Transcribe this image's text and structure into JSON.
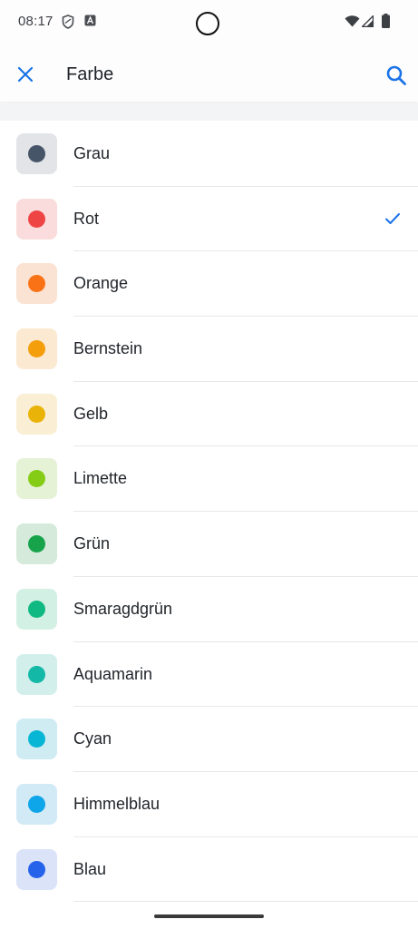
{
  "status_bar": {
    "time": "08:17",
    "icons": [
      "shield-icon",
      "notification-a-icon",
      "wifi-icon",
      "signal-icon",
      "battery-icon"
    ]
  },
  "app_bar": {
    "close_icon": "close-icon",
    "title": "Farbe",
    "search_icon": "search-icon",
    "accent": "#1a73e8"
  },
  "colors": [
    {
      "label": "Grau",
      "dot": "#475569",
      "bg": "#e2e4e7",
      "selected": false
    },
    {
      "label": "Rot",
      "dot": "#ef4444",
      "bg": "#fadcdc",
      "selected": true
    },
    {
      "label": "Orange",
      "dot": "#f97316",
      "bg": "#fbe3d3",
      "selected": false
    },
    {
      "label": "Bernstein",
      "dot": "#f59e0b",
      "bg": "#fbe9d1",
      "selected": false
    },
    {
      "label": "Gelb",
      "dot": "#eab308",
      "bg": "#faefd5",
      "selected": false
    },
    {
      "label": "Limette",
      "dot": "#84cc16",
      "bg": "#e6f2d6",
      "selected": false
    },
    {
      "label": "Grün",
      "dot": "#16a34a",
      "bg": "#d5eadb",
      "selected": false
    },
    {
      "label": "Smaragdgrün",
      "dot": "#10b981",
      "bg": "#d3f0e4",
      "selected": false
    },
    {
      "label": "Aquamarin",
      "dot": "#14b8a6",
      "bg": "#d2efec",
      "selected": false
    },
    {
      "label": "Cyan",
      "dot": "#06b6d4",
      "bg": "#d0ecf3",
      "selected": false
    },
    {
      "label": "Himmelblau",
      "dot": "#0ea5e9",
      "bg": "#d2eaf6",
      "selected": false
    },
    {
      "label": "Blau",
      "dot": "#2563eb",
      "bg": "#dbe3f8",
      "selected": false
    }
  ]
}
